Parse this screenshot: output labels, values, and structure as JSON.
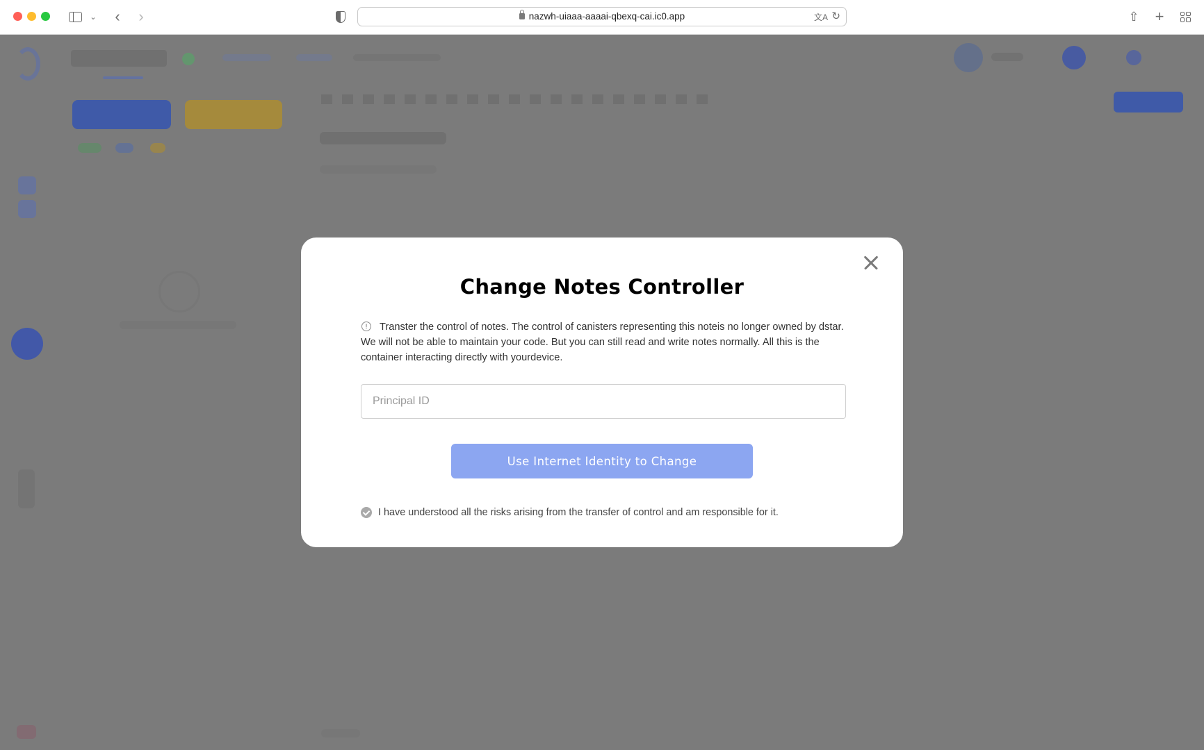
{
  "browser": {
    "url": "nazwh-uiaaa-aaaai-qbexq-cai.ic0.app",
    "icons": {
      "sidebar": "sidebar-icon",
      "back": "chevron-left-icon",
      "forward": "chevron-right-icon",
      "privacy": "shield-icon",
      "lock": "lock-icon",
      "translate": "translate-icon",
      "reload": "reload-icon",
      "share": "share-icon",
      "new_tab": "plus-icon",
      "tab_overview": "grid-icon"
    }
  },
  "modal": {
    "title": "Change Notes Controller",
    "warning_text": "Transter the control of notes. The control of canisters representing this noteis no longer owned by dstar. We will not be able to maintain your code. But you can still read and write notes normally. All this is the container interacting directly with yourdevice.",
    "principal_input": {
      "value": "",
      "placeholder": "Principal ID"
    },
    "primary_button": "Use Internet Identity to Change",
    "acknowledgement": "I have understood all the risks arising from the transfer of control and am responsible for it.",
    "acknowledged": true,
    "close_icon": "close-icon",
    "warning_icon": "info-circle-icon"
  },
  "colors": {
    "overlay": "#7a7a7a",
    "primary_button": "#8ca6f1",
    "modal_bg": "#ffffff"
  }
}
